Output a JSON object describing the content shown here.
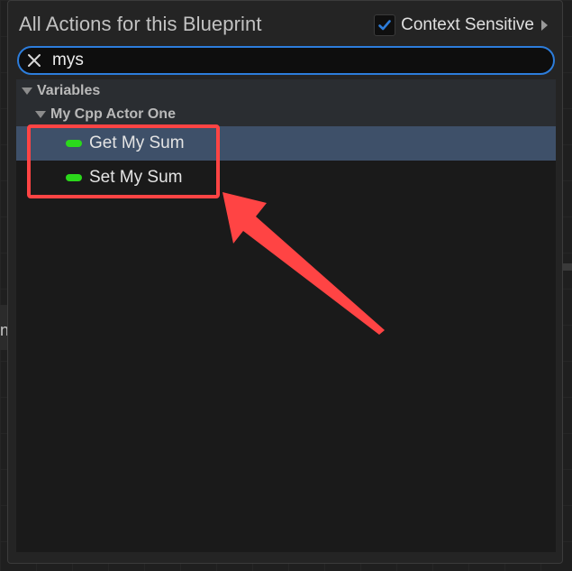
{
  "background": {
    "partial_glyph": "n"
  },
  "panel": {
    "title": "All Actions for this Blueprint",
    "context_sensitive": {
      "label": "Context Sensitive",
      "checked": true
    }
  },
  "search": {
    "value": "mys",
    "clear_icon": "close-icon"
  },
  "results": {
    "categories": [
      {
        "label": "Variables",
        "icon": "collapse-triangle-icon"
      },
      {
        "label": "My Cpp Actor One",
        "icon": "collapse-triangle-icon"
      }
    ],
    "items": [
      {
        "label": "Get My Sum",
        "icon": "variable-pill-icon",
        "selected": true
      },
      {
        "label": "Set My Sum",
        "icon": "variable-pill-icon",
        "selected": false
      }
    ]
  },
  "colors": {
    "accent": "#2d7ddb",
    "selection": "#3e5069",
    "variable_pill": "#2bd81b",
    "annotation": "#ff4444"
  }
}
